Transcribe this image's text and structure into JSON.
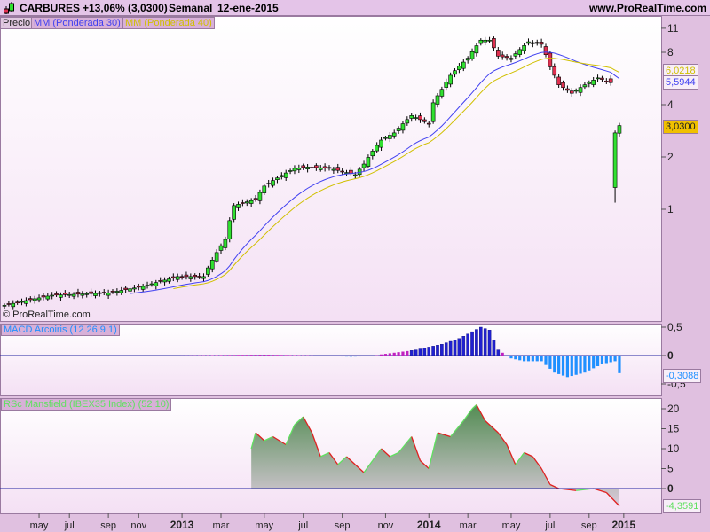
{
  "header": {
    "ticker": "CARBURES",
    "change": "+13,06% (3,0300)",
    "period": "Semanal",
    "date": "12-ene-2015",
    "site": "www.ProRealTime.com"
  },
  "legends": {
    "price": "Precio",
    "ma30": "MM (Ponderada 30)",
    "ma40": "MM (Ponderada 40)",
    "macd": "MACD Arcoiris (12 26 9 1)",
    "rsc": "RSc Mansfield (IBEX35 Index) (52 10)"
  },
  "copyright": "© ProRealTime.com",
  "colors": {
    "up": "#30e030",
    "down": "#e03050",
    "ma30": "#4040f0",
    "ma40": "#d0c000",
    "macd_pos": "#2020d0",
    "macd_small": "#c020c0",
    "macd_neg": "#2090ff",
    "rsc_line": "#e02020"
  },
  "chart_data": [
    {
      "type": "candlestick",
      "title": "CARBURES Semanal",
      "scale": "log",
      "yticks": [
        "11",
        "8",
        "4",
        "2",
        "1"
      ],
      "ytick_values": [
        11,
        8,
        4,
        2,
        1
      ],
      "last_values": {
        "ma40": "6,0218",
        "ma30": "5,5944",
        "price": "3,0300"
      },
      "close_points": [
        [
          0,
          0.28
        ],
        [
          11,
          0.32
        ],
        [
          24,
          0.33
        ],
        [
          32,
          0.36
        ],
        [
          40,
          0.41
        ],
        [
          46,
          0.41
        ],
        [
          48,
          0.51
        ],
        [
          51,
          0.67
        ],
        [
          53,
          1.05
        ],
        [
          58,
          1.14
        ],
        [
          60,
          1.36
        ],
        [
          67,
          1.72
        ],
        [
          70,
          1.75
        ],
        [
          75,
          1.72
        ],
        [
          81,
          1.58
        ],
        [
          83,
          1.82
        ],
        [
          87,
          2.5
        ],
        [
          90,
          2.75
        ],
        [
          94,
          3.46
        ],
        [
          98,
          3.1
        ],
        [
          99,
          4.1
        ],
        [
          101,
          4.9
        ],
        [
          103,
          5.9
        ],
        [
          107,
          7.4
        ],
        [
          110,
          9.4
        ],
        [
          112,
          9.4
        ],
        [
          114,
          7.6
        ],
        [
          117,
          7.4
        ],
        [
          121,
          9.2
        ],
        [
          124,
          8.9
        ],
        [
          126,
          6.6
        ],
        [
          128,
          5.2
        ],
        [
          131,
          4.65
        ],
        [
          134,
          5.2
        ],
        [
          137,
          5.7
        ],
        [
          140,
          5.35
        ],
        [
          141,
          2.75
        ],
        [
          142,
          3.03
        ]
      ],
      "weeks": 143
    },
    {
      "type": "bar",
      "title": "MACD Arcoiris (12 26 9 1)",
      "yticks": [
        "0,5",
        "0",
        "-0,5"
      ],
      "ytick_values": [
        0.5,
        0,
        -0.5
      ],
      "last": "-0,3088",
      "points": [
        [
          0,
          0
        ],
        [
          40,
          0
        ],
        [
          51,
          0.01
        ],
        [
          60,
          0.015
        ],
        [
          70,
          0.005
        ],
        [
          75,
          -0.01
        ],
        [
          80,
          -0.02
        ],
        [
          85,
          -0.01
        ],
        [
          87,
          0.02
        ],
        [
          95,
          0.1
        ],
        [
          98,
          0.15
        ],
        [
          101,
          0.2
        ],
        [
          105,
          0.3
        ],
        [
          110,
          0.5
        ],
        [
          112,
          0.45
        ],
        [
          114,
          0.1
        ],
        [
          117,
          -0.05
        ],
        [
          120,
          -0.1
        ],
        [
          124,
          -0.1
        ],
        [
          127,
          -0.3
        ],
        [
          130,
          -0.38
        ],
        [
          134,
          -0.3
        ],
        [
          138,
          -0.15
        ],
        [
          141,
          -0.1
        ],
        [
          142,
          -0.31
        ]
      ]
    },
    {
      "type": "area",
      "title": "RSc Mansfield (IBEX35 Index) (52 10)",
      "yticks": [
        "20",
        "15",
        "10",
        "5",
        "0"
      ],
      "ytick_values": [
        20,
        15,
        10,
        5,
        0
      ],
      "last": "-4,3591",
      "points": [
        [
          57,
          10
        ],
        [
          58,
          14
        ],
        [
          60,
          12
        ],
        [
          62,
          13
        ],
        [
          65,
          11
        ],
        [
          67,
          16
        ],
        [
          69,
          18
        ],
        [
          71,
          14
        ],
        [
          73,
          8
        ],
        [
          75,
          9
        ],
        [
          77,
          6
        ],
        [
          79,
          8
        ],
        [
          81,
          6
        ],
        [
          83,
          4
        ],
        [
          85,
          7
        ],
        [
          87,
          10
        ],
        [
          89,
          8
        ],
        [
          91,
          9
        ],
        [
          94,
          13
        ],
        [
          96,
          7
        ],
        [
          98,
          5
        ],
        [
          100,
          14
        ],
        [
          103,
          13
        ],
        [
          106,
          17
        ],
        [
          108,
          20
        ],
        [
          109,
          21
        ],
        [
          111,
          17
        ],
        [
          114,
          14
        ],
        [
          116,
          11
        ],
        [
          118,
          6
        ],
        [
          120,
          9
        ],
        [
          122,
          8
        ],
        [
          124,
          5
        ],
        [
          126,
          1
        ],
        [
          128,
          0
        ],
        [
          132,
          -0.5
        ],
        [
          136,
          0
        ],
        [
          139,
          -1
        ],
        [
          142,
          -4.36
        ]
      ]
    },
    {
      "type": "axis",
      "xticks": [
        {
          "label": "may",
          "week": 8
        },
        {
          "label": "jul",
          "week": 15
        },
        {
          "label": "sep",
          "week": 24
        },
        {
          "label": "nov",
          "week": 31
        },
        {
          "label": "2013",
          "week": 41,
          "bold": true
        },
        {
          "label": "mar",
          "week": 50
        },
        {
          "label": "may",
          "week": 60
        },
        {
          "label": "jul",
          "week": 69
        },
        {
          "label": "sep",
          "week": 78
        },
        {
          "label": "nov",
          "week": 88
        },
        {
          "label": "2014",
          "week": 98,
          "bold": true
        },
        {
          "label": "mar",
          "week": 107
        },
        {
          "label": "may",
          "week": 117
        },
        {
          "label": "jul",
          "week": 126
        },
        {
          "label": "sep",
          "week": 135
        },
        {
          "label": "2015",
          "week": 143,
          "bold": true
        }
      ]
    }
  ]
}
